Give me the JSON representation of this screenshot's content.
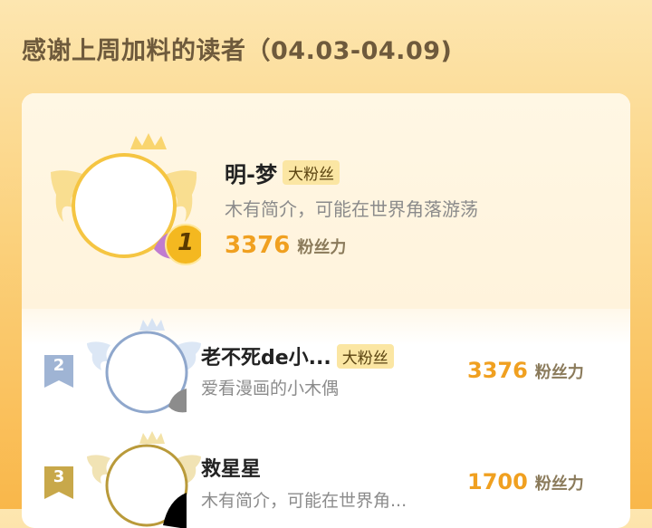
{
  "header": {
    "title": "感谢上周加料的读者（04.03-04.09)"
  },
  "top_reader": {
    "rank": "1",
    "name": "明-梦",
    "badge": "大粉丝",
    "bio": "木有简介，可能在世界角落游荡",
    "score": "3376",
    "score_unit": "粉丝力"
  },
  "readers": [
    {
      "rank": "2",
      "name": "老不死de小...",
      "badge": "大粉丝",
      "bio": "爱看漫画的小木偶",
      "score": "3376",
      "score_unit": "粉丝力"
    },
    {
      "rank": "3",
      "name": "救星星",
      "badge": "",
      "bio": "木有简介，可能在世界角...",
      "score": "1700",
      "score_unit": "粉丝力"
    }
  ],
  "colors": {
    "accent": "#f0a020",
    "gold": "#f5c542",
    "silver": "#9fb4d4",
    "bronze": "#c8a84a"
  }
}
